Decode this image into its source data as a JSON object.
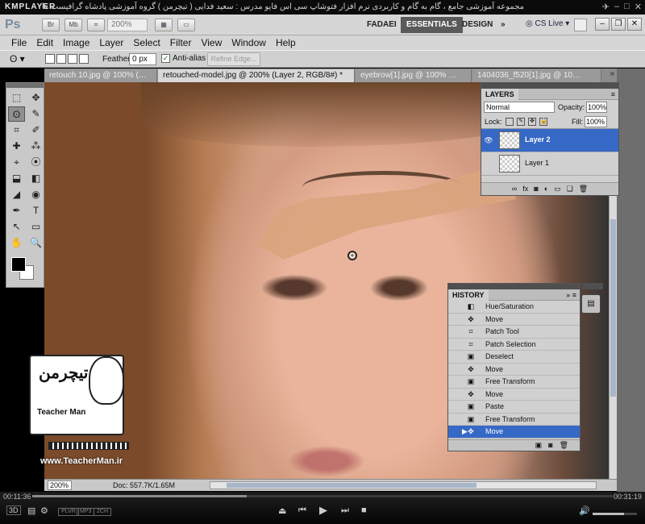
{
  "player": {
    "name": "KMPLAYER",
    "caption": "مجموعه آموزشی جامع ، گام به گام و کاربردی نرم افزار فتوشاپ سی اس فایو  مدرس : سعید فدایی ( تیچرمن ) گروه آموزشی پادشاه گرافیست ها",
    "time_current": "00:11:36",
    "time_total": "00:31:19",
    "progress": 0.37,
    "volume": 0.7,
    "badges": [
      "PLVR",
      "MP3",
      "2CH"
    ],
    "mode_label": "3D"
  },
  "app": {
    "logo": "Ps",
    "chips": [
      "Br",
      "Mb"
    ],
    "zoom": "200%",
    "workspaces": [
      "FADAEI",
      "ESSENTIALS",
      "DESIGN"
    ],
    "active_workspace": "ESSENTIALS",
    "cs_live": "CS Live"
  },
  "menu": [
    "File",
    "Edit",
    "Image",
    "Layer",
    "Select",
    "Filter",
    "View",
    "Window",
    "Help"
  ],
  "options": {
    "feather_label": "Feather:",
    "feather_value": "0 px",
    "anti_alias_label": "Anti-alias",
    "anti_alias_checked": true,
    "refine_edge": "Refine Edge..."
  },
  "tabs": [
    {
      "label": "retouch 10.jpg @ 100% (…"
    },
    {
      "label": "retouched-model.jpg @ 200% (Layer 2, RGB/8#) *"
    },
    {
      "label": "eyebrow[1].jpg @ 100% …"
    },
    {
      "label": "1404036_f520[1].jpg @ 10…"
    }
  ],
  "tools": [
    "⬚",
    "✥",
    "ʘ",
    "✎",
    "⌗",
    "✐",
    "✚",
    "⁂",
    "⌖",
    "⦿",
    "⬓",
    "◧",
    "◢",
    "◉",
    "✒",
    "T",
    "↖",
    "▭",
    "✋",
    "🔍"
  ],
  "status": {
    "zoom": "200%",
    "doc": "Doc: 557.7K/1.65M"
  },
  "layers": {
    "title": "LAYERS",
    "blend": "Normal",
    "opacity_label": "Opacity:",
    "opacity": "100%",
    "lock_label": "Lock:",
    "fill_label": "Fill:",
    "fill": "100%",
    "items": [
      {
        "name": "Layer 2",
        "selected": true,
        "visible": true
      },
      {
        "name": "Layer 1",
        "selected": false,
        "visible": false
      }
    ]
  },
  "history": {
    "title": "HISTORY",
    "items": [
      {
        "name": "Hue/Saturation",
        "icon": "◧"
      },
      {
        "name": "Move",
        "icon": "✥"
      },
      {
        "name": "Patch Tool",
        "icon": "⌗"
      },
      {
        "name": "Patch Selection",
        "icon": "⌗"
      },
      {
        "name": "Deselect",
        "icon": "▣"
      },
      {
        "name": "Move",
        "icon": "✥"
      },
      {
        "name": "Free Transform",
        "icon": "▣"
      },
      {
        "name": "Move",
        "icon": "✥"
      },
      {
        "name": "Paste",
        "icon": "▣"
      },
      {
        "name": "Free Transform",
        "icon": "▣"
      },
      {
        "name": "Move",
        "icon": "✥"
      }
    ],
    "selected_index": 10
  },
  "watermark": {
    "brand_fa": "تیچرمن",
    "brand_en": "Teacher Man",
    "url": "www.TeacherMan.ir"
  }
}
